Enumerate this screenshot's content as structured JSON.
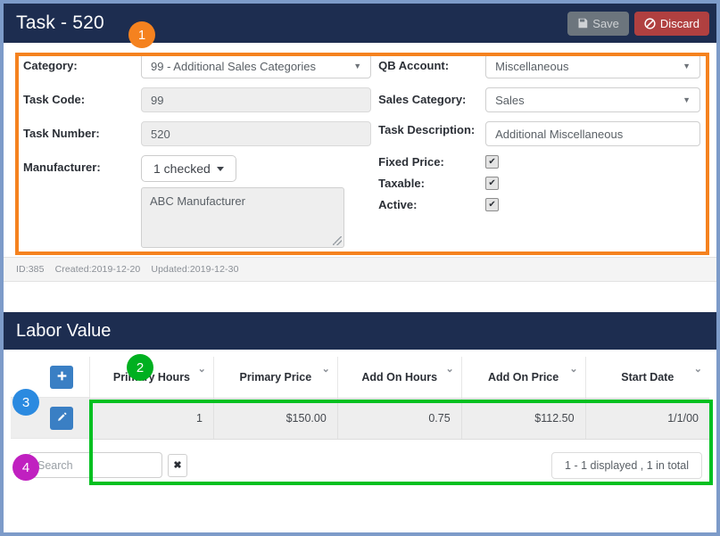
{
  "task_panel": {
    "title": "Task - 520",
    "save_label": "Save",
    "save_icon": "floppy-disk-icon",
    "discard_label": "Discard",
    "discard_icon": "no-entry-icon",
    "fields": {
      "category_label": "Category:",
      "category_value": "99 - Additional Sales Categories",
      "task_code_label": "Task Code:",
      "task_code_value": "99",
      "task_number_label": "Task Number:",
      "task_number_value": "520",
      "manufacturer_label": "Manufacturer:",
      "manufacturer_button": "1 checked",
      "manufacturer_list": "ABC Manufacturer",
      "qb_account_label": "QB Account:",
      "qb_account_value": "Miscellaneous",
      "sales_category_label": "Sales Category:",
      "sales_category_value": "Sales",
      "task_description_label": "Task Description:",
      "task_description_value": "Additional Miscellaneous",
      "fixed_price_label": "Fixed Price:",
      "fixed_price_checked": "✔",
      "taxable_label": "Taxable:",
      "taxable_checked": "✔",
      "active_label": "Active:",
      "active_checked": "✔"
    },
    "meta": {
      "id": "ID:385",
      "created": "Created:2019-12-20",
      "updated": "Updated:2019-12-30"
    }
  },
  "labor_value": {
    "title": "Labor Value",
    "add_button_icon": "plus-icon",
    "edit_button_icon": "pencil-icon",
    "columns": [
      "Primary Hours",
      "Primary Price",
      "Add On Hours",
      "Add On Price",
      "Start Date"
    ],
    "sort_caret": "⌄",
    "rows": [
      [
        "1",
        "$150.00",
        "0.75",
        "$112.50",
        "1/1/00"
      ]
    ],
    "search_placeholder": "Search",
    "search_value": "",
    "clear_icon": "✖",
    "count_text": "1 - 1 displayed , 1 in total"
  },
  "annotations": [
    {
      "number": "1",
      "color": "#f5821f"
    },
    {
      "number": "2",
      "color": "#00b020"
    },
    {
      "number": "3",
      "color": "#2b8ae0"
    },
    {
      "number": "4",
      "color": "#c020c0"
    }
  ],
  "theme": {
    "header_bg": "#1d2d50",
    "highlight_orange": "#f5821f",
    "highlight_green": "#00c020",
    "page_border": "#7d9bc9"
  }
}
